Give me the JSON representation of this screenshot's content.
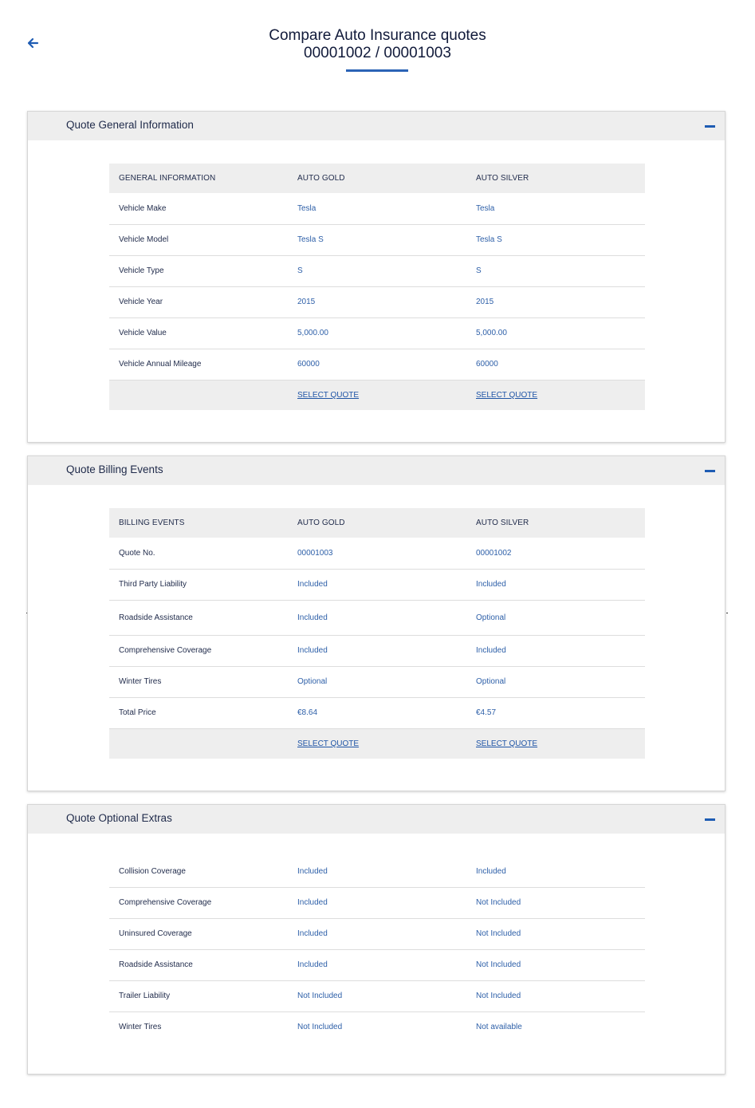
{
  "header": {
    "title": "Compare Auto Insurance quotes",
    "subtitle": "00001002 / 00001003",
    "back_icon": "arrow-left-icon"
  },
  "colors": {
    "accent": "#2b63b6",
    "link": "#2055a6",
    "section_bg": "#eeeeee"
  },
  "sections": [
    {
      "title": "Quote General Information",
      "columns": [
        "GENERAL INFORMATION",
        "AUTO GOLD",
        "AUTO SILVER"
      ],
      "rows": [
        {
          "label": "Vehicle Make",
          "gold": "Tesla",
          "silver": "Tesla"
        },
        {
          "label": "Vehicle Model",
          "gold": "Tesla S",
          "silver": "Tesla S"
        },
        {
          "label": "Vehicle Type",
          "gold": "S",
          "silver": "S"
        },
        {
          "label": "Vehicle Year",
          "gold": "2015",
          "silver": "2015"
        },
        {
          "label": "Vehicle Value",
          "gold": "5,000.00",
          "silver": "5,000.00"
        },
        {
          "label": "Vehicle Annual Mileage",
          "gold": "60000",
          "silver": "60000"
        }
      ],
      "select_label": "SELECT QUOTE"
    },
    {
      "title": "Quote Billing Events",
      "columns": [
        "BILLING EVENTS",
        "AUTO GOLD",
        "AUTO SILVER"
      ],
      "rows": [
        {
          "label": "Quote No.",
          "gold": "00001003",
          "silver": "00001002"
        },
        {
          "label": "Third Party Liability",
          "gold": "Included",
          "silver": "Included"
        },
        {
          "label": "Roadside Assistance",
          "gold": "Included",
          "silver": "Optional"
        },
        {
          "label": "Comprehensive Coverage",
          "gold": "Included",
          "silver": "Included"
        },
        {
          "label": "Winter Tires",
          "gold": "Optional",
          "silver": "Optional"
        },
        {
          "label": "Total Price",
          "gold": "€8.64",
          "silver": "€4.57"
        }
      ],
      "select_label": "SELECT QUOTE"
    },
    {
      "title": "Quote Optional Extras",
      "rows": [
        {
          "label": "Collision Coverage",
          "gold": "Included",
          "silver": "Included"
        },
        {
          "label": "Comprehensive Coverage",
          "gold": "Included",
          "silver": "Not Included"
        },
        {
          "label": "Uninsured Coverage",
          "gold": "Included",
          "silver": "Not Included"
        },
        {
          "label": "Roadside Assistance",
          "gold": "Included",
          "silver": "Not Included"
        },
        {
          "label": "Trailer Liability",
          "gold": "Not Included",
          "silver": "Not Included"
        },
        {
          "label": "Winter Tires",
          "gold": "Not Included",
          "silver": "Not available"
        }
      ]
    }
  ]
}
